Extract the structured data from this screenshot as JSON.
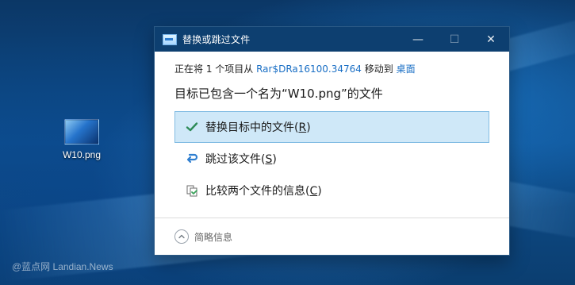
{
  "desktop": {
    "file_icon_label": "W10.png",
    "watermark": "@蓝点网 Landian.News"
  },
  "dialog": {
    "title": "替换或跳过文件",
    "window_controls": {
      "minimize_glyph": "—",
      "maximize_glyph": "☐",
      "close_glyph": "✕"
    },
    "path_line": {
      "prefix": "正在将 1 个项目从",
      "source": "Rar$DRa16100.34764",
      "middle": "移动到",
      "destination": "桌面"
    },
    "headline": "目标已包含一个名为“W10.png”的文件",
    "options": [
      {
        "id": "replace",
        "icon": "check-icon",
        "label_before": "替换目标中的文件(",
        "mnemonic": "R",
        "label_after": ")",
        "selected": true
      },
      {
        "id": "skip",
        "icon": "skip-icon",
        "label_before": "跳过该文件(",
        "mnemonic": "S",
        "label_after": ")",
        "selected": false
      },
      {
        "id": "compare",
        "icon": "compare-icon",
        "label_before": "比较两个文件的信息(",
        "mnemonic": "C",
        "label_after": ")",
        "selected": false
      }
    ],
    "footer": {
      "toggle_icon": "chevron-up-icon",
      "label": "简略信息"
    },
    "colors": {
      "titlebar": "#0d3f70",
      "selected_bg": "#cfe8f8",
      "selected_border": "#82bce3",
      "link": "#1a6fc5",
      "check": "#2e8b57",
      "skip": "#2f7fd0",
      "compare": "#3aa35b"
    }
  }
}
